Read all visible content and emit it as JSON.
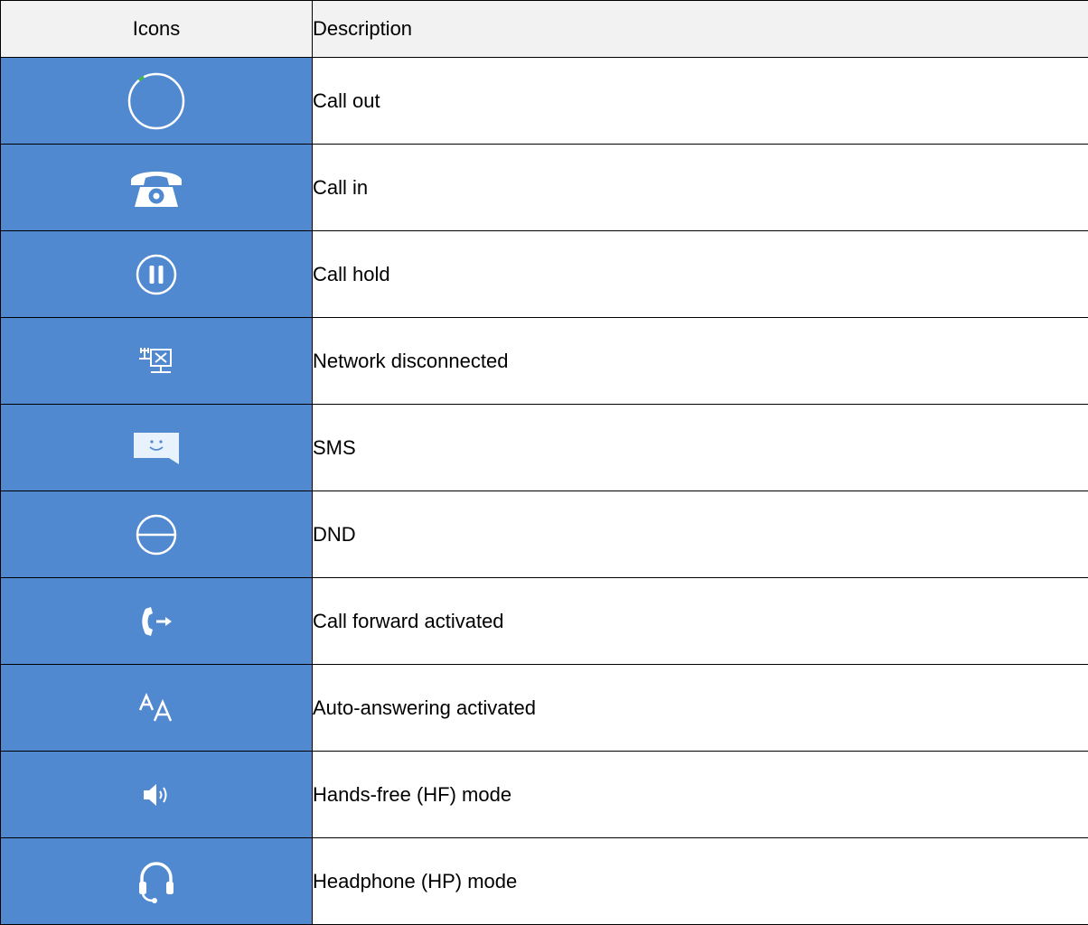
{
  "header": {
    "icons_label": "Icons",
    "description_label": "Description"
  },
  "colors": {
    "icon_cell_bg": "#5189d1",
    "header_bg": "#f2f2f2",
    "icon_fg": "#ffffff",
    "accent_green": "#3dbb3d"
  },
  "rows": [
    {
      "icon": "call-out-icon",
      "description": "Call out"
    },
    {
      "icon": "call-in-icon",
      "description": "Call in"
    },
    {
      "icon": "call-hold-icon",
      "description": "Call hold"
    },
    {
      "icon": "network-disconnected-icon",
      "description": "Network disconnected"
    },
    {
      "icon": "sms-icon",
      "description": "SMS"
    },
    {
      "icon": "dnd-icon",
      "description": "DND"
    },
    {
      "icon": "call-forward-icon",
      "description": "Call forward activated"
    },
    {
      "icon": "auto-answer-icon",
      "description": "Auto-answering activated"
    },
    {
      "icon": "hands-free-icon",
      "description": "Hands-free (HF) mode"
    },
    {
      "icon": "headphone-icon",
      "description": "Headphone (HP) mode"
    }
  ]
}
